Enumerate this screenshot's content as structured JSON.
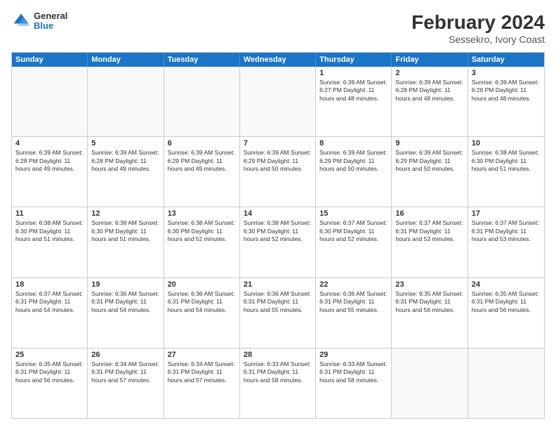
{
  "header": {
    "logo": {
      "general": "General",
      "blue": "Blue"
    },
    "title": "February 2024",
    "subtitle": "Sessekro, Ivory Coast"
  },
  "weekdays": [
    "Sunday",
    "Monday",
    "Tuesday",
    "Wednesday",
    "Thursday",
    "Friday",
    "Saturday"
  ],
  "rows": [
    [
      {
        "day": "",
        "info": ""
      },
      {
        "day": "",
        "info": ""
      },
      {
        "day": "",
        "info": ""
      },
      {
        "day": "",
        "info": ""
      },
      {
        "day": "1",
        "info": "Sunrise: 6:39 AM\nSunset: 6:27 PM\nDaylight: 11 hours\nand 48 minutes."
      },
      {
        "day": "2",
        "info": "Sunrise: 6:39 AM\nSunset: 6:28 PM\nDaylight: 11 hours\nand 48 minutes."
      },
      {
        "day": "3",
        "info": "Sunrise: 6:39 AM\nSunset: 6:28 PM\nDaylight: 11 hours\nand 48 minutes."
      }
    ],
    [
      {
        "day": "4",
        "info": "Sunrise: 6:39 AM\nSunset: 6:28 PM\nDaylight: 11 hours\nand 49 minutes."
      },
      {
        "day": "5",
        "info": "Sunrise: 6:39 AM\nSunset: 6:28 PM\nDaylight: 11 hours\nand 49 minutes."
      },
      {
        "day": "6",
        "info": "Sunrise: 6:39 AM\nSunset: 6:29 PM\nDaylight: 11 hours\nand 49 minutes."
      },
      {
        "day": "7",
        "info": "Sunrise: 6:39 AM\nSunset: 6:29 PM\nDaylight: 11 hours\nand 50 minutes."
      },
      {
        "day": "8",
        "info": "Sunrise: 6:39 AM\nSunset: 6:29 PM\nDaylight: 11 hours\nand 50 minutes."
      },
      {
        "day": "9",
        "info": "Sunrise: 6:39 AM\nSunset: 6:29 PM\nDaylight: 11 hours\nand 50 minutes."
      },
      {
        "day": "10",
        "info": "Sunrise: 6:38 AM\nSunset: 6:30 PM\nDaylight: 11 hours\nand 51 minutes."
      }
    ],
    [
      {
        "day": "11",
        "info": "Sunrise: 6:38 AM\nSunset: 6:30 PM\nDaylight: 11 hours\nand 51 minutes."
      },
      {
        "day": "12",
        "info": "Sunrise: 6:38 AM\nSunset: 6:30 PM\nDaylight: 11 hours\nand 51 minutes."
      },
      {
        "day": "13",
        "info": "Sunrise: 6:38 AM\nSunset: 6:30 PM\nDaylight: 11 hours\nand 52 minutes."
      },
      {
        "day": "14",
        "info": "Sunrise: 6:38 AM\nSunset: 6:30 PM\nDaylight: 11 hours\nand 52 minutes."
      },
      {
        "day": "15",
        "info": "Sunrise: 6:37 AM\nSunset: 6:30 PM\nDaylight: 11 hours\nand 52 minutes."
      },
      {
        "day": "16",
        "info": "Sunrise: 6:37 AM\nSunset: 6:31 PM\nDaylight: 11 hours\nand 53 minutes."
      },
      {
        "day": "17",
        "info": "Sunrise: 6:37 AM\nSunset: 6:31 PM\nDaylight: 11 hours\nand 53 minutes."
      }
    ],
    [
      {
        "day": "18",
        "info": "Sunrise: 6:37 AM\nSunset: 6:31 PM\nDaylight: 11 hours\nand 54 minutes."
      },
      {
        "day": "19",
        "info": "Sunrise: 6:36 AM\nSunset: 6:31 PM\nDaylight: 11 hours\nand 54 minutes."
      },
      {
        "day": "20",
        "info": "Sunrise: 6:36 AM\nSunset: 6:31 PM\nDaylight: 11 hours\nand 54 minutes."
      },
      {
        "day": "21",
        "info": "Sunrise: 6:36 AM\nSunset: 6:31 PM\nDaylight: 11 hours\nand 55 minutes."
      },
      {
        "day": "22",
        "info": "Sunrise: 6:36 AM\nSunset: 6:31 PM\nDaylight: 11 hours\nand 55 minutes."
      },
      {
        "day": "23",
        "info": "Sunrise: 6:35 AM\nSunset: 6:31 PM\nDaylight: 11 hours\nand 56 minutes."
      },
      {
        "day": "24",
        "info": "Sunrise: 6:35 AM\nSunset: 6:31 PM\nDaylight: 11 hours\nand 56 minutes."
      }
    ],
    [
      {
        "day": "25",
        "info": "Sunrise: 6:35 AM\nSunset: 6:31 PM\nDaylight: 11 hours\nand 56 minutes."
      },
      {
        "day": "26",
        "info": "Sunrise: 6:34 AM\nSunset: 6:31 PM\nDaylight: 11 hours\nand 57 minutes."
      },
      {
        "day": "27",
        "info": "Sunrise: 6:34 AM\nSunset: 6:31 PM\nDaylight: 11 hours\nand 57 minutes."
      },
      {
        "day": "28",
        "info": "Sunrise: 6:33 AM\nSunset: 6:31 PM\nDaylight: 11 hours\nand 58 minutes."
      },
      {
        "day": "29",
        "info": "Sunrise: 6:33 AM\nSunset: 6:31 PM\nDaylight: 11 hours\nand 58 minutes."
      },
      {
        "day": "",
        "info": ""
      },
      {
        "day": "",
        "info": ""
      }
    ]
  ]
}
